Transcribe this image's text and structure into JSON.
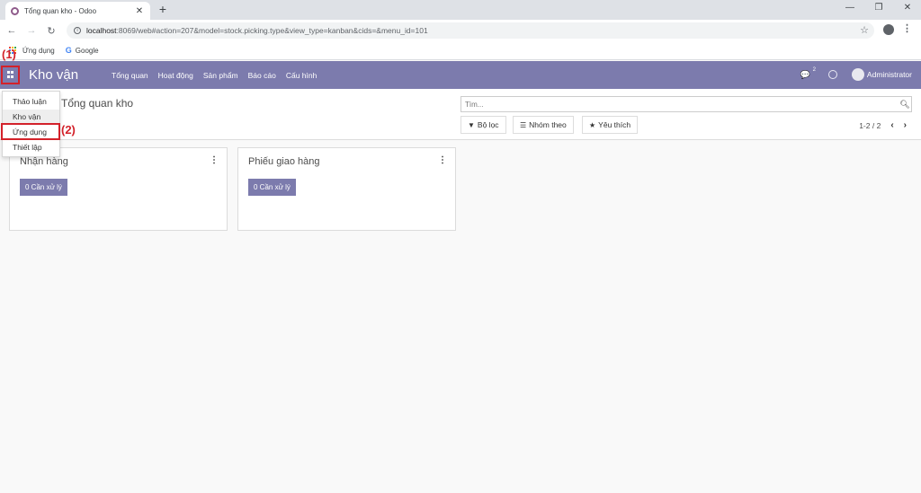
{
  "browser": {
    "tab_title": "Tổng quan kho - Odoo",
    "tab_close": "✕",
    "new_tab": "+",
    "url_host": "localhost",
    "url_rest": ":8069/web#action=207&model=stock.picking.type&view_type=kanban&cids=&menu_id=101",
    "bookmarks": [
      {
        "label": "Ứng dụng",
        "icon": "apps-grid-icon"
      },
      {
        "label": "Google",
        "icon": "google-icon"
      }
    ]
  },
  "odoo_nav": {
    "brand": "Kho vận",
    "menu": [
      "Tổng quan",
      "Hoạt động",
      "Sản phẩm",
      "Báo cáo",
      "Cấu hình"
    ],
    "chat_count": "2",
    "user": "Administrator",
    "color": "#7c7bad"
  },
  "annotations": {
    "label1": "(1)",
    "label2": "(2)",
    "color": "#d3212a"
  },
  "dropdown": {
    "items": [
      "Thảo luận",
      "Kho vận",
      "Ứng dụng",
      "Thiết lập"
    ]
  },
  "control_panel": {
    "breadcrumb": "Tổng quan kho",
    "search_placeholder": "Tìm...",
    "filter_label": "Bộ lọc",
    "group_label": "Nhóm theo",
    "favorite_label": "Yêu thích",
    "pager": "1-2 / 2"
  },
  "kanban": {
    "cards": [
      {
        "name": "Nhận hàng",
        "action": "0 Cần xử lý"
      },
      {
        "name": "Phiếu giao hàng",
        "action": "0 Cần xử lý"
      }
    ]
  }
}
